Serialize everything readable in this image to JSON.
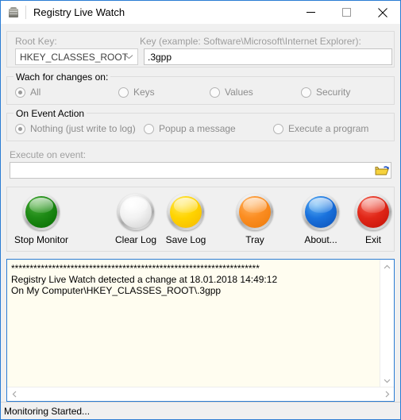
{
  "window": {
    "title": "Registry Live Watch",
    "icon": "registry-app-icon",
    "controls": {
      "minimize": "minimize-icon",
      "maximize": "maximize-icon",
      "close": "close-icon"
    }
  },
  "key_section": {
    "root_key_label": "Root Key:",
    "root_key_value": "HKEY_CLASSES_ROOT",
    "key_label": "Key (example: Software\\Microsoft\\Internet Explorer):",
    "key_value": ".3gpp",
    "key_placeholder": ""
  },
  "watch_group": {
    "title": "Wach for changes on:",
    "options": [
      {
        "label": "All",
        "checked": true
      },
      {
        "label": "Keys",
        "checked": false
      },
      {
        "label": "Values",
        "checked": false
      },
      {
        "label": "Security",
        "checked": false
      }
    ]
  },
  "action_group": {
    "title": "On Event Action",
    "options": [
      {
        "label": "Nothing (just write to log)",
        "checked": true
      },
      {
        "label": "Popup a message",
        "checked": false
      },
      {
        "label": "Execute a program",
        "checked": false
      }
    ]
  },
  "execute_section": {
    "label": "Execute on event:",
    "value": "",
    "placeholder": "",
    "browse_icon": "open-folder-icon"
  },
  "buttons": [
    {
      "label": "Stop Monitor",
      "color": "#1f8b16",
      "name": "stop-monitor"
    },
    {
      "label": "Clear Log",
      "color": "#f2f2f2",
      "name": "clear-log"
    },
    {
      "label": "Save Log",
      "color": "#ffd400",
      "name": "save-log"
    },
    {
      "label": "Tray",
      "color": "#fb8d22",
      "name": "tray"
    },
    {
      "label": "About...",
      "color": "#1a72dd",
      "name": "about"
    },
    {
      "label": "Exit",
      "color": "#e12718",
      "name": "exit"
    }
  ],
  "log": {
    "lines": [
      "*******************************************************************",
      "Registry Live Watch detected a change at 18.01.2018 14:49:12",
      "On My Computer\\HKEY_CLASSES_ROOT\\.3gpp"
    ],
    "text": "*******************************************************************\nRegistry Live Watch detected a change at 18.01.2018 14:49:12\nOn My Computer\\HKEY_CLASSES_ROOT\\.3gpp"
  },
  "statusbar": {
    "text": "Monitoring Started..."
  },
  "colors": {
    "window_border": "#2b7cd3",
    "log_background": "#fffdf0",
    "panel_background": "#f0f0f0",
    "disabled_text": "#9d9d9d"
  }
}
